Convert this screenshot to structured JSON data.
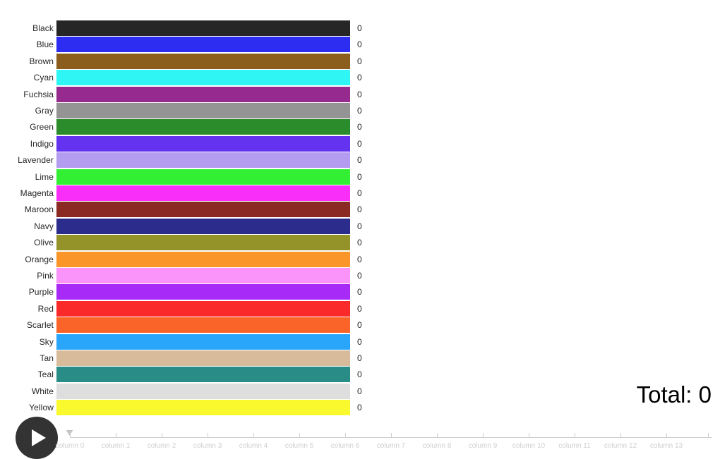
{
  "chart_data": {
    "type": "bar",
    "orientation": "horizontal",
    "title": "",
    "xlabel": "",
    "ylabel": "",
    "grid": false,
    "legend": null,
    "xlim": [
      0,
      1
    ],
    "value_label_format": "integer",
    "categories": [
      "Black",
      "Blue",
      "Brown",
      "Cyan",
      "Fuchsia",
      "Gray",
      "Green",
      "Indigo",
      "Lavender",
      "Lime",
      "Magenta",
      "Maroon",
      "Navy",
      "Olive",
      "Orange",
      "Pink",
      "Purple",
      "Red",
      "Scarlet",
      "Sky",
      "Tan",
      "Teal",
      "White",
      "Yellow"
    ],
    "values": [
      0,
      0,
      0,
      0,
      0,
      0,
      0,
      0,
      0,
      0,
      0,
      0,
      0,
      0,
      0,
      0,
      0,
      0,
      0,
      0,
      0,
      0,
      0,
      0
    ],
    "value_labels": [
      "0",
      "0",
      "0",
      "0",
      "0",
      "0",
      "0",
      "0",
      "0",
      "0",
      "0",
      "0",
      "0",
      "0",
      "0",
      "0",
      "0",
      "0",
      "0",
      "0",
      "0",
      "0",
      "0",
      "0"
    ],
    "bar_colors": [
      "#262626",
      "#2d2df2",
      "#8c5e1e",
      "#2ff5f5",
      "#962a8f",
      "#949494",
      "#2b8c2b",
      "#6333ef",
      "#b49cf0",
      "#33ef33",
      "#f92ef9",
      "#8a2a22",
      "#2c2c8c",
      "#93932a",
      "#fa9629",
      "#fa94fa",
      "#a82af7",
      "#fa2a2a",
      "#fa6428",
      "#29a5fa",
      "#d8bb9a",
      "#2a8c87",
      "#dedede",
      "#f9f92e"
    ]
  },
  "total": {
    "label": "Total: 0"
  },
  "transport": {
    "play_icon": "play-triangle-icon",
    "play_label": "Play"
  },
  "timeline": {
    "handle_position_index": 0,
    "ticks": [
      {
        "label": "column 0"
      },
      {
        "label": "column 1"
      },
      {
        "label": "column 2"
      },
      {
        "label": "column 3"
      },
      {
        "label": "column 4"
      },
      {
        "label": "column 5"
      },
      {
        "label": "column 6"
      },
      {
        "label": "column 7"
      },
      {
        "label": "column 8"
      },
      {
        "label": "column 9"
      },
      {
        "label": "column 10"
      },
      {
        "label": "column 11"
      },
      {
        "label": "column 12"
      },
      {
        "label": "column 13"
      }
    ]
  },
  "colors": {
    "background": "#ffffff",
    "text": "#262626",
    "muted_text": "#cfcfcf",
    "track": "#d0d0d0",
    "play_button": "#333333",
    "play_glyph": "#ffffff"
  }
}
